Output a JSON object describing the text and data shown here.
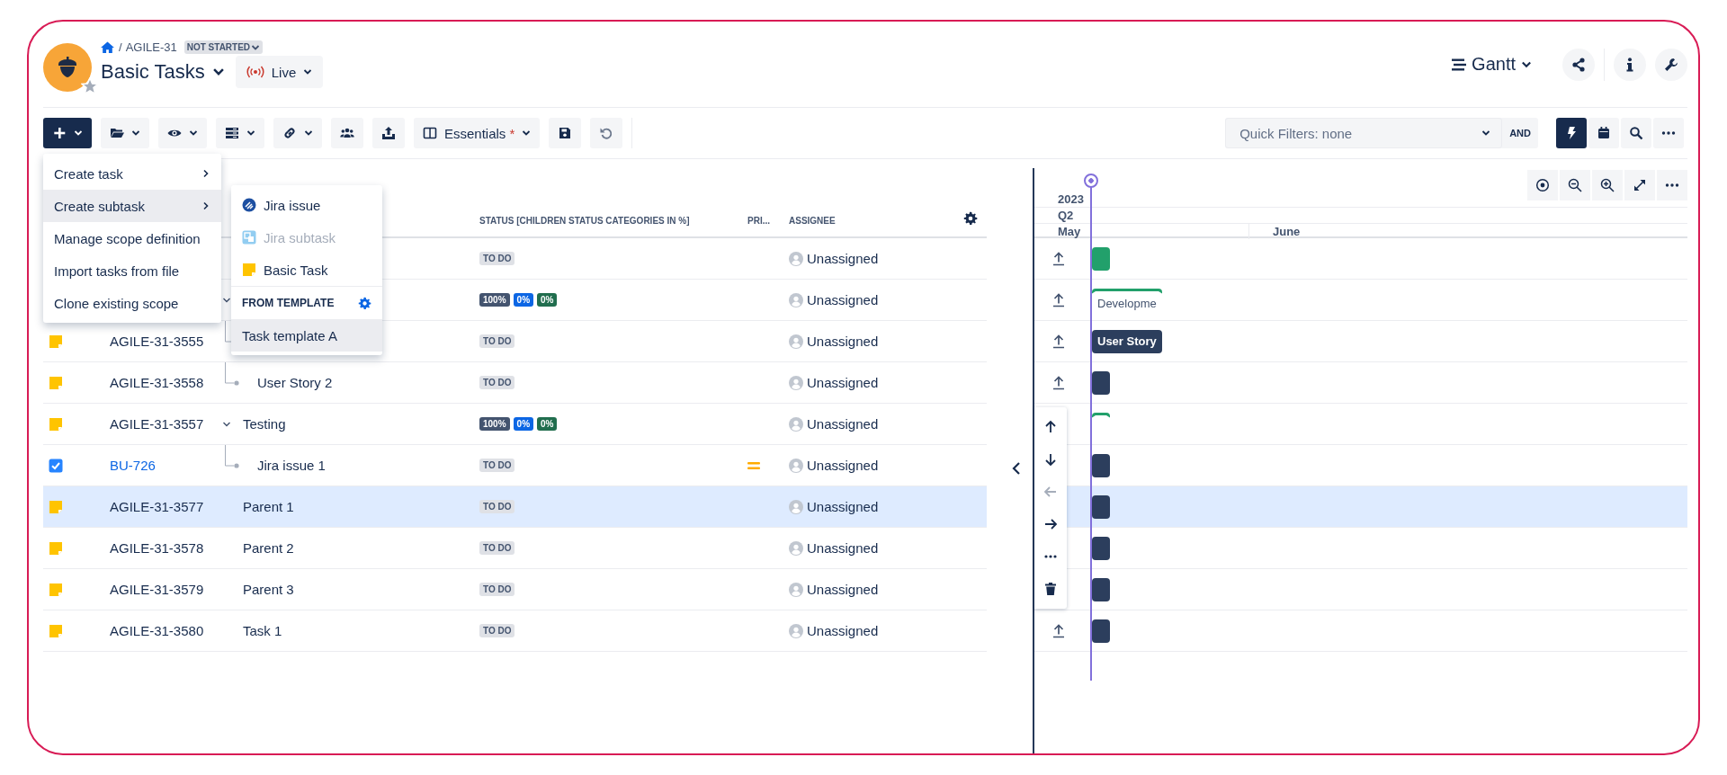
{
  "header": {
    "breadcrumb": {
      "separator": "/",
      "project": "AGILE-31",
      "status": "NOT STARTED"
    },
    "title": "Basic Tasks",
    "mode": {
      "label": "Live"
    },
    "view": {
      "label": "Gantt"
    }
  },
  "toolbar": {
    "tools": [
      {
        "kind": "add",
        "active": true,
        "dropdown": true
      },
      {
        "kind": "folder",
        "active": false,
        "dropdown": true
      },
      {
        "kind": "eye",
        "active": false,
        "dropdown": true
      },
      {
        "kind": "rows",
        "active": false,
        "dropdown": true
      },
      {
        "kind": "link",
        "active": false,
        "dropdown": true
      },
      {
        "kind": "team",
        "active": false,
        "dropdown": false
      },
      {
        "kind": "export",
        "active": false,
        "dropdown": false
      },
      {
        "kind": "columns",
        "label": "Essentials",
        "modified": "*",
        "active": false,
        "dropdown": true
      },
      {
        "kind": "save",
        "active": false,
        "dropdown": false
      },
      {
        "kind": "undo",
        "active": false,
        "dropdown": false
      }
    ],
    "quick_filter": {
      "value": "Quick Filters: none",
      "operator": "AND"
    },
    "view_tools": [
      {
        "kind": "bolt",
        "active": true
      },
      {
        "kind": "calendar",
        "active": false
      },
      {
        "kind": "search",
        "active": false
      },
      {
        "kind": "more",
        "active": false
      }
    ]
  },
  "create_menu": {
    "items": [
      {
        "label": "Create task",
        "submenu": true,
        "selected": false
      },
      {
        "label": "Create subtask",
        "submenu": true,
        "selected": true
      },
      {
        "label": "Manage scope definition",
        "submenu": false,
        "selected": false
      },
      {
        "label": "Import tasks from file",
        "submenu": false,
        "selected": false
      },
      {
        "label": "Clone existing scope",
        "submenu": false,
        "selected": false
      }
    ]
  },
  "subtask_menu": {
    "items": [
      {
        "label": "Jira issue",
        "kind": "jira",
        "disabled": false
      },
      {
        "label": "Jira subtask",
        "kind": "subtask",
        "disabled": true
      },
      {
        "label": "Basic Task",
        "kind": "basic",
        "disabled": false
      }
    ],
    "section": "FROM TEMPLATE",
    "templates": [
      {
        "label": "Task template A",
        "selected": true
      }
    ]
  },
  "table": {
    "columns": [
      "STATUS [CHILDREN STATUS CATEGORIES IN %]",
      "PRI...",
      "ASSIGNEE"
    ],
    "rows": [
      {
        "status": {
          "kind": "todo",
          "label": "TO DO"
        },
        "assignee": "Unassigned",
        "selected": false
      },
      {
        "expanded": true,
        "status": {
          "kind": "progress",
          "labels": [
            "100%",
            "0%",
            "0%"
          ]
        },
        "assignee": "Unassigned",
        "selected": false,
        "children": [
          {
            "kind": "basic",
            "id": "AGILE-31-3555",
            "status": {
              "kind": "todo",
              "label": "TO DO"
            },
            "assignee": "Unassigned",
            "selected": false
          },
          {
            "kind": "basic",
            "id": "AGILE-31-3558",
            "title": "User Story 2",
            "status": {
              "kind": "todo",
              "label": "TO DO"
            },
            "assignee": "Unassigned",
            "selected": false
          }
        ]
      },
      {
        "kind": "basic",
        "id": "AGILE-31-3557",
        "title": "Testing",
        "expanded": true,
        "status": {
          "kind": "progress",
          "labels": [
            "100%",
            "0%",
            "0%"
          ]
        },
        "assignee": "Unassigned",
        "selected": false,
        "children": [
          {
            "kind": "jira",
            "id": "BU-726",
            "title": "Jira issue 1",
            "status": {
              "kind": "todo",
              "label": "TO DO"
            },
            "medium_priority": true,
            "assignee": "Unassigned",
            "selected": false
          }
        ]
      },
      {
        "kind": "basic",
        "id": "AGILE-31-3577",
        "title": "Parent 1",
        "status": {
          "kind": "todo",
          "label": "TO DO"
        },
        "assignee": "Unassigned",
        "selected": true
      },
      {
        "kind": "basic",
        "id": "AGILE-31-3578",
        "title": "Parent 2",
        "status": {
          "kind": "todo",
          "label": "TO DO"
        },
        "assignee": "Unassigned",
        "selected": false
      },
      {
        "kind": "basic",
        "id": "AGILE-31-3579",
        "title": "Parent 3",
        "status": {
          "kind": "todo",
          "label": "TO DO"
        },
        "assignee": "Unassigned",
        "selected": false
      },
      {
        "kind": "basic",
        "id": "AGILE-31-3580",
        "title": "Task 1",
        "status": {
          "kind": "todo",
          "label": "TO DO"
        },
        "assignee": "Unassigned",
        "selected": false
      }
    ]
  },
  "gantt": {
    "year": "2023",
    "quarter": "Q2",
    "months": [
      "May",
      "June"
    ],
    "rows": [
      {
        "upload": true,
        "selected": false,
        "bar": {
          "kind": "task",
          "color": "#22a06b"
        }
      },
      {
        "upload": true,
        "selected": false,
        "bar": {
          "kind": "group",
          "color": "#22a06b",
          "label": "Developme"
        }
      },
      {
        "upload": true,
        "selected": false,
        "bar": {
          "kind": "task",
          "color": "#2c3e5d",
          "label": "User Story"
        }
      },
      {
        "upload": true,
        "selected": false,
        "bar": {
          "kind": "task",
          "color": "#2c3e5d"
        }
      },
      {
        "upload": false,
        "selected": false,
        "bar": {
          "kind": "group",
          "color": "#22a06b"
        }
      },
      {
        "upload": false,
        "selected": false,
        "bar": {
          "kind": "task",
          "color": "#2c3e5d"
        }
      },
      {
        "upload": false,
        "selected": true,
        "bar": {
          "kind": "task",
          "color": "#2c3e5d"
        }
      },
      {
        "upload": false,
        "selected": false,
        "bar": {
          "kind": "task",
          "color": "#2c3e5d"
        }
      },
      {
        "upload": false,
        "selected": false,
        "bar": {
          "kind": "task",
          "color": "#2c3e5d"
        }
      },
      {
        "upload": true,
        "selected": false,
        "bar": {
          "kind": "task",
          "color": "#2c3e5d"
        }
      }
    ],
    "row_tools": [
      {
        "kind": "up",
        "disabled": false
      },
      {
        "kind": "down",
        "disabled": false
      },
      {
        "kind": "left",
        "disabled": true
      },
      {
        "kind": "right",
        "disabled": false
      },
      {
        "kind": "more",
        "disabled": false
      },
      {
        "kind": "delete",
        "disabled": false
      }
    ]
  }
}
